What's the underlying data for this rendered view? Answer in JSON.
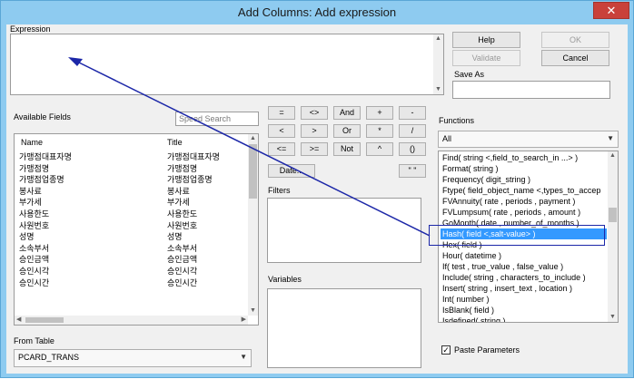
{
  "window": {
    "title": "Add Columns: Add expression",
    "close_glyph": "✕"
  },
  "expression": {
    "label": "Expression",
    "value": ""
  },
  "buttons": {
    "help": "Help",
    "ok": "OK",
    "validate": "Validate",
    "cancel": "Cancel",
    "date": "Date...",
    "quotes": "\" \""
  },
  "save_as": {
    "label": "Save As",
    "value": ""
  },
  "available_fields": {
    "label": "Available Fields",
    "search_placeholder": "Speed Search",
    "columns": [
      "Name",
      "Title"
    ],
    "rows": [
      [
        "가맹점대표자명",
        "가맹점대표자명"
      ],
      [
        "가맹점명",
        "가맹점명"
      ],
      [
        "가맹점업종명",
        "가맹점업종명"
      ],
      [
        "봉사료",
        "봉사료"
      ],
      [
        "부가세",
        "부가세"
      ],
      [
        "사용한도",
        "사용한도"
      ],
      [
        "사원번호",
        "사원번호"
      ],
      [
        "성명",
        "성명"
      ],
      [
        "소속부서",
        "소속부서"
      ],
      [
        "승인금액",
        "승인금액"
      ],
      [
        "승인시각",
        "승인시각"
      ],
      [
        "승인시간",
        "승인시간"
      ]
    ]
  },
  "from_table": {
    "label": "From Table",
    "value": "PCARD_TRANS"
  },
  "operators": [
    [
      "=",
      "<>",
      "And",
      "+",
      "-"
    ],
    [
      "<",
      ">",
      "Or",
      "*",
      "/"
    ],
    [
      "<=",
      ">=",
      "Not",
      "^",
      "()"
    ]
  ],
  "filters": {
    "label": "Filters"
  },
  "variables": {
    "label": "Variables"
  },
  "functions": {
    "label": "Functions",
    "category": "All",
    "items": [
      "Find( string <,field_to_search_in ...> )",
      "Format( string )",
      "Frequency( digit_string )",
      "Ftype( field_object_name <,types_to_accep",
      "FVAnnuity( rate , periods , payment )",
      "FVLumpsum( rate , periods , amount )",
      "GoMonth( date , number_of_months )",
      "Hash( field <,salt-value> )",
      "Hex( field )",
      "Hour( datetime )",
      "If( test , true_value , false_value )",
      "Include( string , characters_to_include )",
      "Insert( string , insert_text , location )",
      "Int( number )",
      "IsBlank( field )",
      "Isdefined( string )"
    ],
    "selected_index": 7
  },
  "paste_parameters": {
    "label": "Paste Parameters",
    "checked": true
  }
}
